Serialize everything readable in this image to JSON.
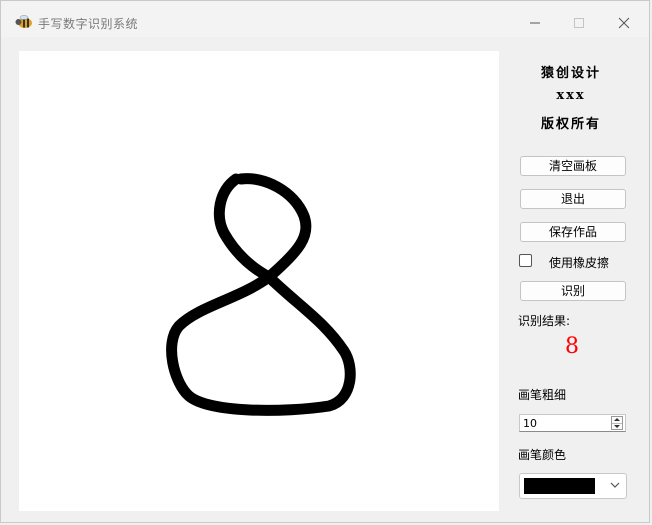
{
  "window": {
    "title": "手写数字识别系统"
  },
  "credits": {
    "line1": "猿创设计",
    "line2": "xxx",
    "line3": "版权所有"
  },
  "buttons": {
    "clear": "清空画板",
    "exit": "退出",
    "save": "保存作品",
    "recognize": "识别"
  },
  "eraser": {
    "label": "使用橡皮擦",
    "checked": false
  },
  "result": {
    "label": "识别结果:",
    "value": "8",
    "color": "#ff0000"
  },
  "pen_width": {
    "label": "画笔粗细",
    "value": "10"
  },
  "pen_color": {
    "label": "画笔颜色",
    "value": "#000000"
  }
}
